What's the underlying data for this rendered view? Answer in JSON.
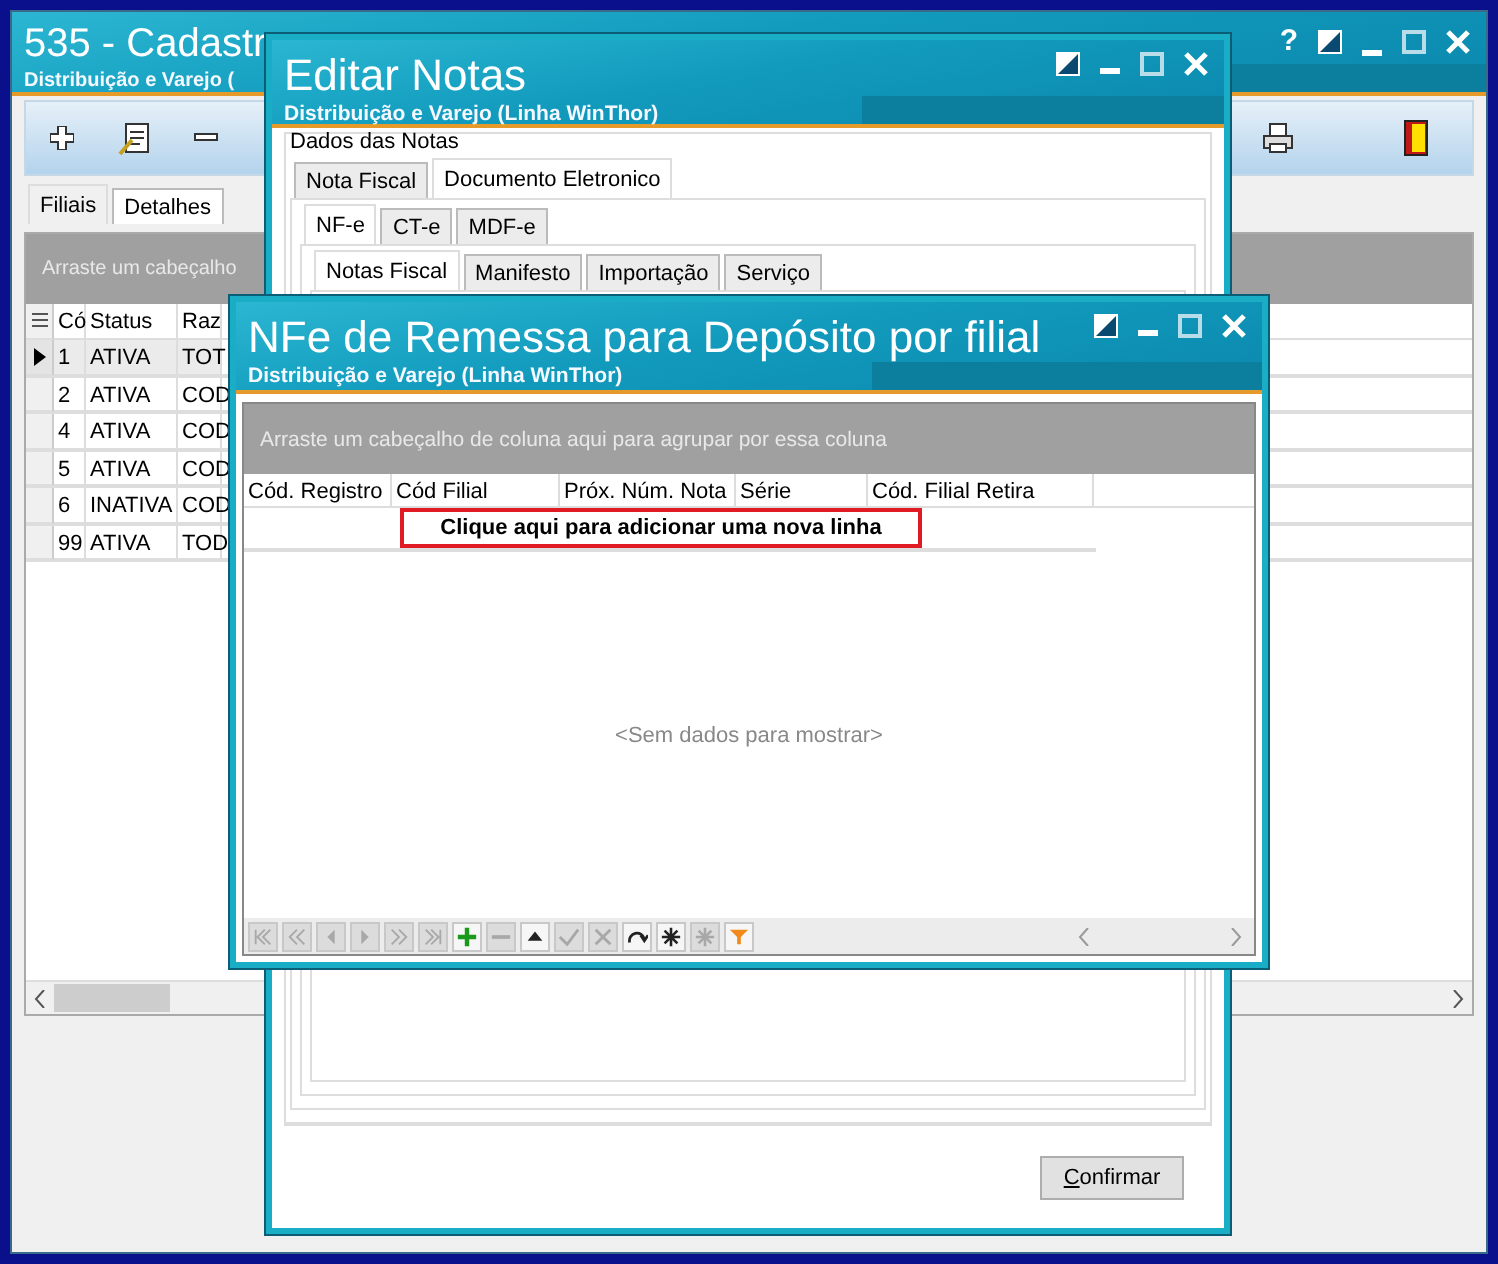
{
  "main_window": {
    "title": "535 - Cadastr",
    "subtitle": "Distribuição e Varejo (",
    "help_button": "?",
    "tabs": [
      {
        "label": "Filiais",
        "selected": true
      },
      {
        "label": "Detalhes",
        "selected": false
      }
    ],
    "grid": {
      "group_hint": "Arraste um cabeçalho",
      "columns": [
        "Có",
        "Status",
        "Raz"
      ],
      "rows": [
        {
          "cells": [
            "1",
            "ATIVA",
            "TOT"
          ],
          "selected": true
        },
        {
          "cells": [
            "2",
            "ATIVA",
            "COD"
          ],
          "selected": false
        },
        {
          "cells": [
            "4",
            "ATIVA",
            "COD"
          ],
          "selected": false
        },
        {
          "cells": [
            "5",
            "ATIVA",
            "COD"
          ],
          "selected": false
        },
        {
          "cells": [
            "6",
            "INATIVA",
            "COD"
          ],
          "selected": false
        },
        {
          "cells": [
            "99",
            "ATIVA",
            "TOD"
          ],
          "selected": false
        }
      ]
    }
  },
  "editar_notas": {
    "title": "Editar Notas",
    "subtitle": "Distribuição e Varejo (Linha WinThor)",
    "group_label": "Dados das Notas",
    "tabs": [
      {
        "label": "Nota Fiscal",
        "selected": false
      },
      {
        "label": "Documento Eletronico",
        "selected": true
      }
    ],
    "document_tabs": [
      {
        "label": "NF-e",
        "selected": true
      },
      {
        "label": "CT-e",
        "selected": false
      },
      {
        "label": "MDF-e",
        "selected": false
      }
    ],
    "nfe_tabs": [
      {
        "label": "Notas Fiscal",
        "selected": true
      },
      {
        "label": "Manifesto",
        "selected": false
      },
      {
        "label": "Importação",
        "selected": false
      },
      {
        "label": "Serviço",
        "selected": false
      }
    ],
    "confirm_button": "Confirmar"
  },
  "nfe_window": {
    "title": "NFe de Remessa para Depósito por filial",
    "subtitle": "Distribuição e Varejo (Linha WinThor)",
    "group_hint": "Arraste um cabeçalho de coluna aqui para agrupar por essa coluna",
    "columns": [
      "Cód. Registro",
      "Cód Filial",
      "Próx. Núm. Nota",
      "Série",
      "Cód. Filial Retira"
    ],
    "new_row_prompt": "Clique aqui para adicionar uma nova linha",
    "empty_message": "<Sem dados para mostrar>",
    "navigator": [
      {
        "kind": "first",
        "disabled": true
      },
      {
        "kind": "prev-page",
        "disabled": true
      },
      {
        "kind": "prev",
        "disabled": true
      },
      {
        "kind": "next",
        "disabled": true
      },
      {
        "kind": "next-page",
        "disabled": true
      },
      {
        "kind": "last",
        "disabled": true
      },
      {
        "kind": "add",
        "disabled": false
      },
      {
        "kind": "remove",
        "disabled": true
      },
      {
        "kind": "up",
        "disabled": false
      },
      {
        "kind": "ok",
        "disabled": true
      },
      {
        "kind": "cancel",
        "disabled": true
      },
      {
        "kind": "refresh",
        "disabled": false
      },
      {
        "kind": "star",
        "disabled": false
      },
      {
        "kind": "star",
        "disabled": true
      },
      {
        "kind": "filter",
        "disabled": false
      }
    ]
  }
}
